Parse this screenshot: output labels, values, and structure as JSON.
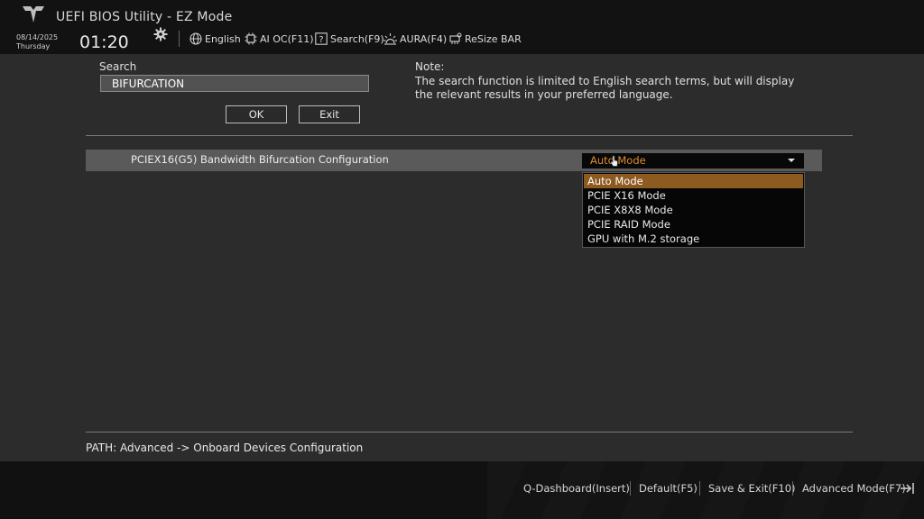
{
  "header": {
    "title": "UEFI BIOS Utility - EZ Mode",
    "date": "08/14/2025",
    "day": "Thursday",
    "time": "01:20",
    "buttons": [
      {
        "label": "English",
        "icon": "globe-icon"
      },
      {
        "label": "AI OC(F11)",
        "icon": "chip-icon"
      },
      {
        "label": "Search(F9)",
        "icon": "question-icon"
      },
      {
        "label": "AURA(F4)",
        "icon": "aura-light-icon"
      },
      {
        "label": "ReSize BAR",
        "icon": "resize-bar-icon"
      }
    ]
  },
  "search": {
    "label": "Search",
    "value": "BIFURCATION",
    "ok_label": "OK",
    "exit_label": "Exit"
  },
  "note": {
    "title": "Note:",
    "text": "The search function is limited to English search terms, but will display the relevant results in your preferred language."
  },
  "setting": {
    "label": "PCIEX16(G5) Bandwidth Bifurcation Configuration",
    "selected": "Auto Mode",
    "options": [
      "Auto Mode",
      "PCIE X16 Mode",
      "PCIE X8X8 Mode",
      "PCIE RAID Mode",
      "GPU with M.2 storage"
    ]
  },
  "path": "PATH: Advanced -> Onboard Devices Configuration",
  "footer": {
    "buttons": [
      "Q-Dashboard(Insert)",
      "Default(F5)",
      "Save & Exit(F10)",
      "Advanced Mode(F7)"
    ]
  },
  "colors": {
    "accent": "#e08b2e",
    "selected_option_bg": "#8d5a1f",
    "row_bg": "#5a5a5a"
  }
}
